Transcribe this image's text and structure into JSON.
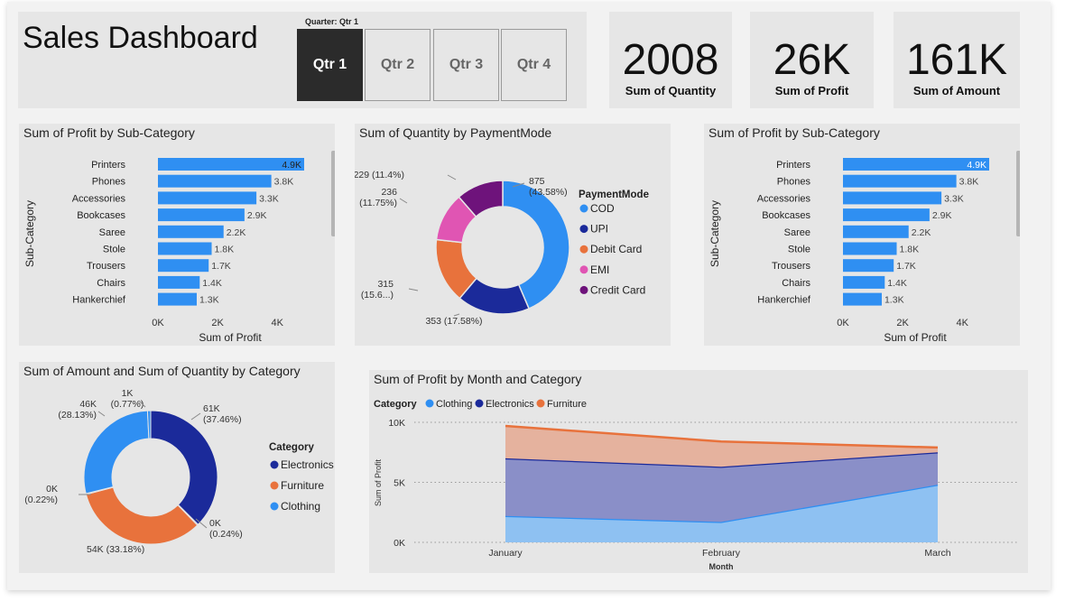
{
  "dashboard": {
    "title": "Sales Dashboard"
  },
  "slicer": {
    "label": "Quarter: Qtr 1",
    "options": [
      "Qtr 1",
      "Qtr 2",
      "Qtr 3",
      "Qtr 4"
    ],
    "selected": "Qtr 1"
  },
  "kpis": [
    {
      "value": "2008",
      "label": "Sum of Quantity"
    },
    {
      "value": "26K",
      "label": "Sum of Profit"
    },
    {
      "value": "161K",
      "label": "Sum of Amount"
    }
  ],
  "colors": {
    "bar": "#2f8ff2",
    "cod": "#2f8ff2",
    "upi": "#1b2a9a",
    "debit": "#e8723c",
    "emi": "#e055b3",
    "credit": "#6e137b",
    "electronics": "#1b2a9a",
    "furniture": "#e8723c",
    "clothing": "#2f8ff2"
  },
  "chart_data": [
    {
      "id": "bar1",
      "type": "bar",
      "orientation": "horizontal",
      "title": "Sum of Profit by Sub-Category",
      "xlabel": "Sum of Profit",
      "ylabel": "Sub-Category",
      "categories": [
        "Printers",
        "Phones",
        "Accessories",
        "Bookcases",
        "Saree",
        "Stole",
        "Trousers",
        "Chairs",
        "Hankerchief"
      ],
      "values": [
        4900,
        3800,
        3300,
        2900,
        2200,
        1800,
        1700,
        1400,
        1300
      ],
      "value_labels": [
        "4.9K",
        "3.8K",
        "3.3K",
        "2.9K",
        "2.2K",
        "1.8K",
        "1.7K",
        "1.4K",
        "1.3K"
      ],
      "xticks": [
        "0K",
        "2K",
        "4K"
      ],
      "xlim": [
        0,
        4900
      ]
    },
    {
      "id": "donut1",
      "type": "pie",
      "title": "Sum of Quantity by PaymentMode",
      "legend_title": "PaymentMode",
      "slices": [
        {
          "name": "COD",
          "value": 875,
          "label": "875\n(43.58%)"
        },
        {
          "name": "UPI",
          "value": 353,
          "label": "353 (17.58%)"
        },
        {
          "name": "Debit Card",
          "value": 315,
          "label": "315\n(15.6...)"
        },
        {
          "name": "EMI",
          "value": 236,
          "label": "236\n(11.75%)"
        },
        {
          "name": "Credit Card",
          "value": 229,
          "label": "229 (11.4%)"
        }
      ]
    },
    {
      "id": "bar2",
      "type": "bar",
      "orientation": "horizontal",
      "title": "Sum of Profit by Sub-Category",
      "xlabel": "Sum of Profit",
      "ylabel": "Sub-Category",
      "categories": [
        "Printers",
        "Phones",
        "Accessories",
        "Bookcases",
        "Saree",
        "Stole",
        "Trousers",
        "Chairs",
        "Hankerchief"
      ],
      "values": [
        4900,
        3800,
        3300,
        2900,
        2200,
        1800,
        1700,
        1400,
        1300
      ],
      "value_labels": [
        "4.9K",
        "3.8K",
        "3.3K",
        "2.9K",
        "2.2K",
        "1.8K",
        "1.7K",
        "1.4K",
        "1.3K"
      ],
      "xticks": [
        "0K",
        "2K",
        "4K"
      ],
      "xlim": [
        0,
        4900
      ]
    },
    {
      "id": "donut2",
      "type": "pie",
      "title": "Sum of Amount and Sum of Quantity by Category",
      "legend_title": "Category",
      "legend": [
        "Electronics",
        "Furniture",
        "Clothing"
      ],
      "slices": [
        {
          "name": "Electronics",
          "value": 37.46,
          "label": "61K\n(37.46%)"
        },
        {
          "name": "Electronics",
          "value": 0.24,
          "label": "0K\n(0.24%)"
        },
        {
          "name": "Furniture",
          "value": 33.18,
          "label": "54K (33.18%)"
        },
        {
          "name": "Furniture",
          "value": 0.22,
          "label": "0K\n(0.22%)"
        },
        {
          "name": "Clothing",
          "value": 28.13,
          "label": "46K\n(28.13%)"
        },
        {
          "name": "Clothing",
          "value": 0.77,
          "label": "1K\n(0.77%)"
        }
      ]
    },
    {
      "id": "area1",
      "type": "area",
      "stacked": true,
      "title": "Sum of Profit by Month and Category",
      "legend_title": "Category",
      "xlabel": "Month",
      "ylabel": "Sum of Profit",
      "x": [
        "January",
        "February",
        "March"
      ],
      "yticks": [
        "0K",
        "5K",
        "10K"
      ],
      "ylim": [
        0,
        10000
      ],
      "series": [
        {
          "name": "Clothing",
          "values": [
            2200,
            1700,
            4800
          ]
        },
        {
          "name": "Electronics",
          "values": [
            4800,
            4600,
            2700
          ]
        },
        {
          "name": "Furniture",
          "values": [
            2700,
            2100,
            400
          ]
        }
      ]
    }
  ]
}
